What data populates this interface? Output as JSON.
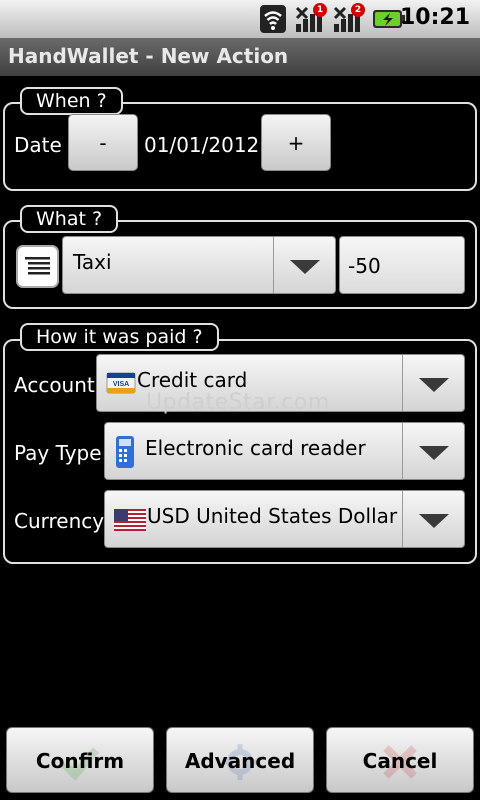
{
  "status_bar": {
    "time": "10:21",
    "badges": [
      "1",
      "2"
    ],
    "icons": [
      "wifi-icon",
      "signal-1-icon",
      "signal-2-icon",
      "battery-charging-icon"
    ]
  },
  "title": "HandWallet - New Action",
  "when": {
    "legend": "When ?",
    "date_label": "Date",
    "minus_label": "-",
    "date_value": "01/01/2012",
    "plus_label": "+"
  },
  "what": {
    "legend": "What ?",
    "category_value": "Taxi",
    "amount_value": "-50"
  },
  "how": {
    "legend": "How it was paid ?",
    "account_label": "Account",
    "account_value": "Credit card",
    "paytype_label": "Pay Type",
    "paytype_value": "Electronic card reader",
    "currency_label": "Currency",
    "currency_value": "USD United States Dollar"
  },
  "watermark": "UpdateStar.com",
  "buttons": {
    "confirm": "Confirm",
    "advanced": "Advanced",
    "cancel": "Cancel"
  },
  "colors": {
    "frame": "#e0e0e0",
    "card_flag_red": "#b22234",
    "card_flag_blue": "#3c3b6e",
    "visa_blue": "#1a3f9a"
  }
}
